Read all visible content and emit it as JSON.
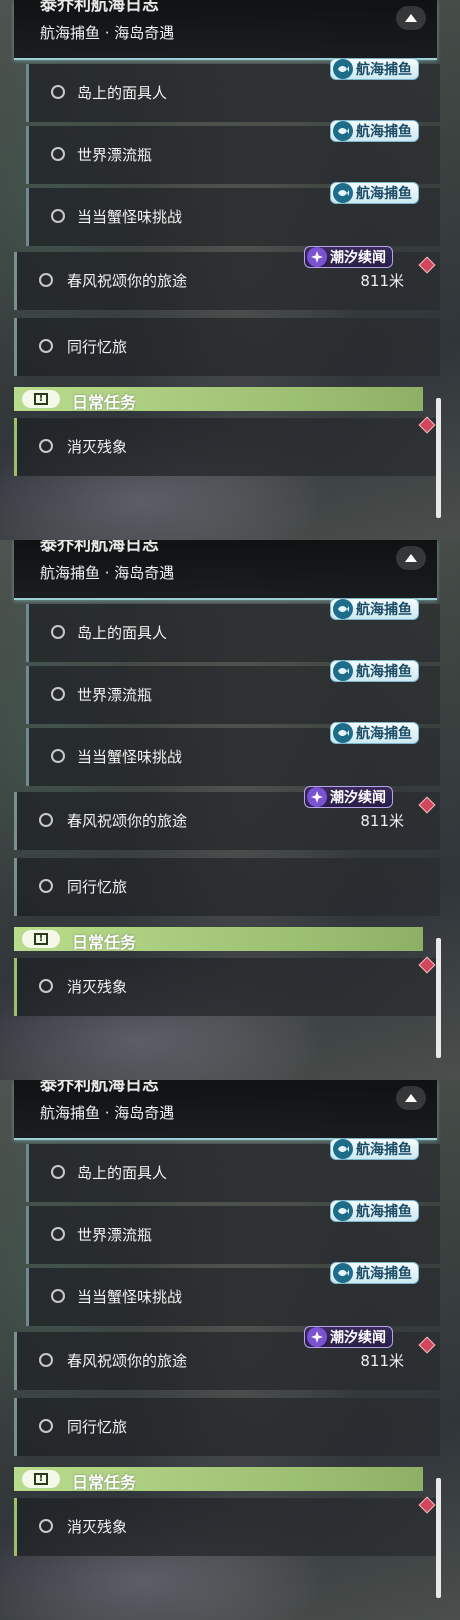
{
  "header": {
    "title": "泰乔利航海日志",
    "subtitle": "航海捕鱼 · 海岛奇遇"
  },
  "tags": {
    "fishing": "航海捕鱼",
    "tide": "潮汐续闻"
  },
  "quests": [
    {
      "label": "岛上的面具人",
      "tag": "航海捕鱼",
      "kind": "sub"
    },
    {
      "label": "世界漂流瓶",
      "tag": "航海捕鱼",
      "kind": "sub"
    },
    {
      "label": "当当蟹怪味挑战",
      "tag": "航海捕鱼",
      "kind": "sub"
    },
    {
      "label": "春风祝颂你的旅途",
      "tag": "潮汐续闻",
      "kind": "main",
      "distance": "811米"
    },
    {
      "label": "同行忆旅",
      "kind": "main"
    }
  ],
  "daily": {
    "title": "日常任务",
    "quests": [
      {
        "label": "消灭残象"
      }
    ]
  },
  "colors": {
    "accent_cyan": "#9fd0d8",
    "daily_green": "#b9dc8c",
    "tide_purple": "#7a52d2",
    "marker_red": "#d0465a"
  },
  "repeat_count_note": "panel repeated three times vertically"
}
